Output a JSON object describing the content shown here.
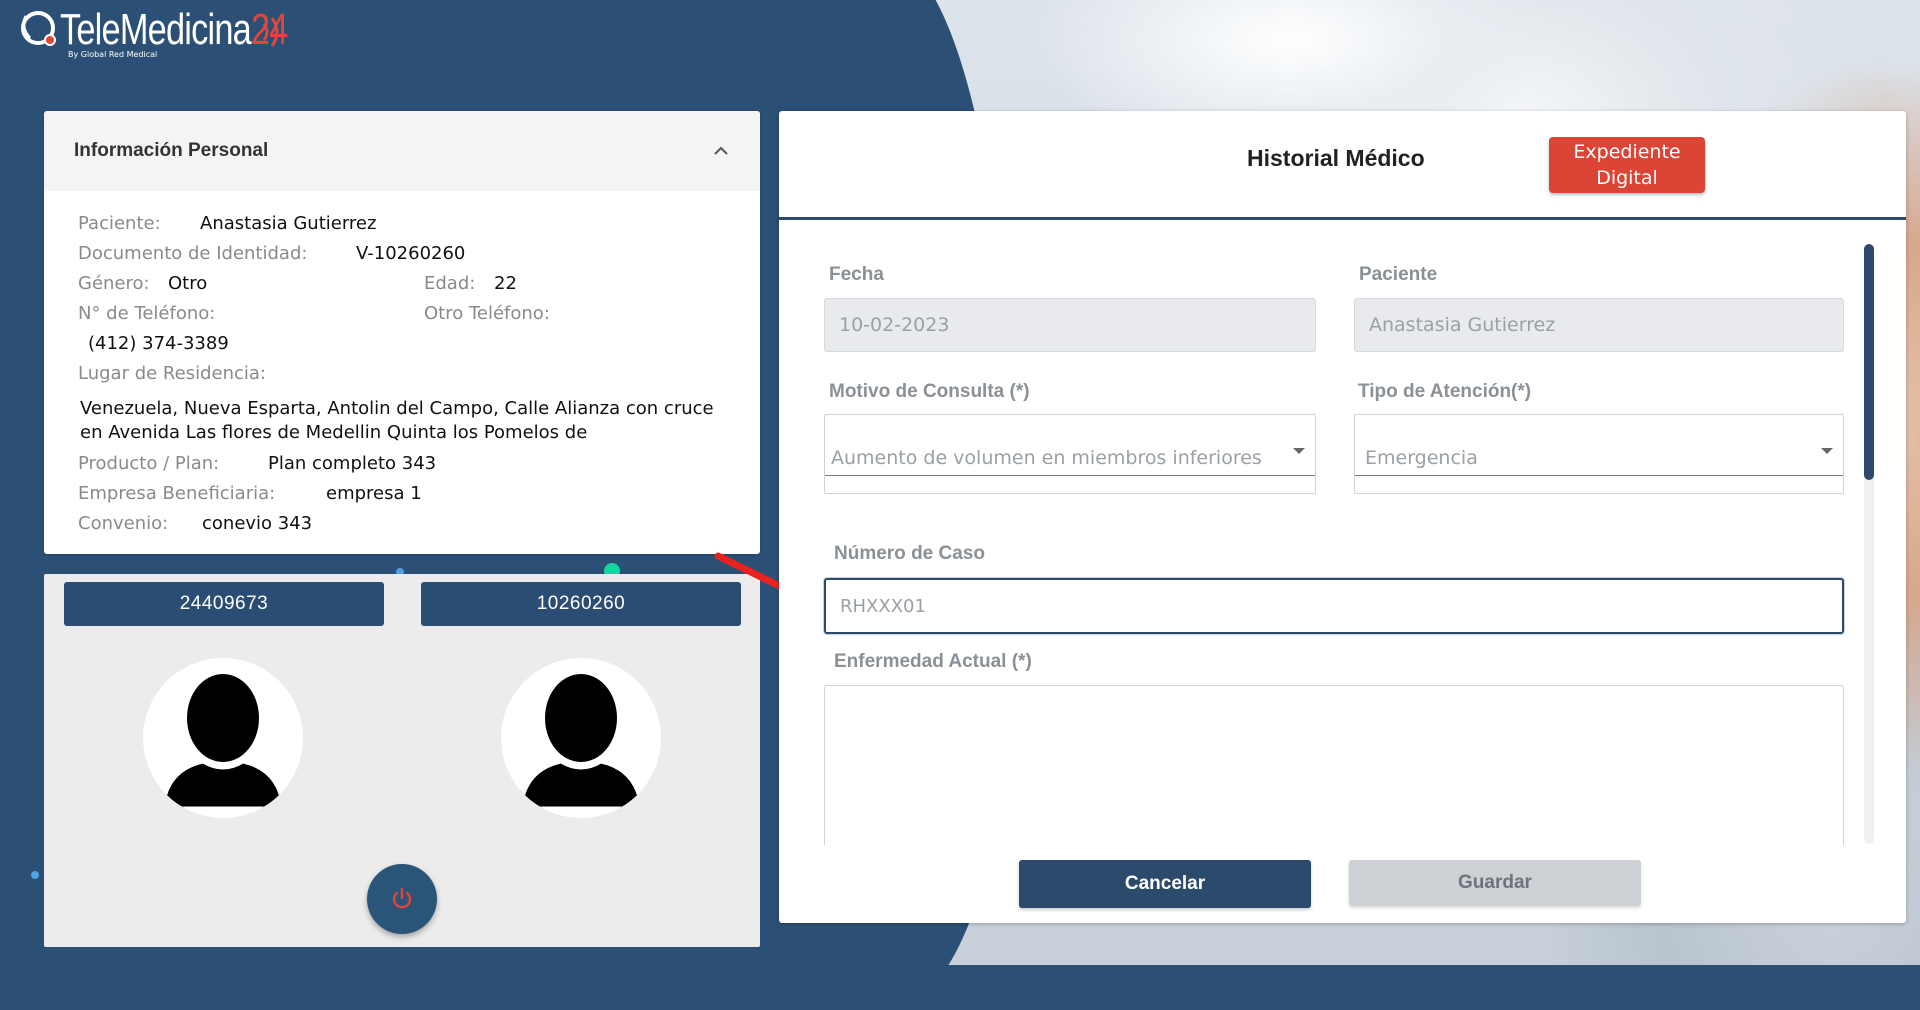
{
  "brand": {
    "name": "TeleMedicina",
    "number": "24",
    "tagline": "By Global Red Medical"
  },
  "info": {
    "title": "Información Personal",
    "patient_label": "Paciente:",
    "patient": "Anastasia Gutierrez",
    "doc_label": "Documento de Identidad:",
    "doc": "V-10260260",
    "gender_label": "Género:",
    "gender": "Otro",
    "age_label": "Edad:",
    "age": "22",
    "phone_label": "N° de Teléfono:",
    "other_phone_label": "Otro Teléfono:",
    "phone": "(412) 374-3389",
    "residence_label": "Lugar de Residencia:",
    "residence": "Venezuela, Nueva Esparta, Antolin del Campo, Calle Alianza con cruce en Avenida Las flores de Medellin Quinta los Pomelos de",
    "plan_label": "Producto / Plan:",
    "plan": "Plan completo 343",
    "company_label": "Empresa Beneficiaria:",
    "company": "empresa 1",
    "agreement_label": "Convenio:",
    "agreement": "conevio 343"
  },
  "video": {
    "left_id": "24409673",
    "right_id": "10260260"
  },
  "medical": {
    "title": "Historial Médico",
    "digital_record": "Expediente Digital",
    "date_label": "Fecha",
    "date": "10-02-2023",
    "patient_label": "Paciente",
    "patient": "Anastasia Gutierrez",
    "reason_label": "Motivo de Consulta (*)",
    "reason": "Aumento de volumen en miembros inferiores",
    "attention_label": "Tipo de Atención(*)",
    "attention": "Emergencia",
    "case_label": "Número de Caso",
    "case_placeholder": "RHXXX01",
    "illness_label": "Enfermedad Actual (*)",
    "cancel": "Cancelar",
    "save": "Guardar"
  },
  "colors": {
    "primary": "#2c4a6b",
    "accent": "#dc4536",
    "background": "#2c5075"
  }
}
